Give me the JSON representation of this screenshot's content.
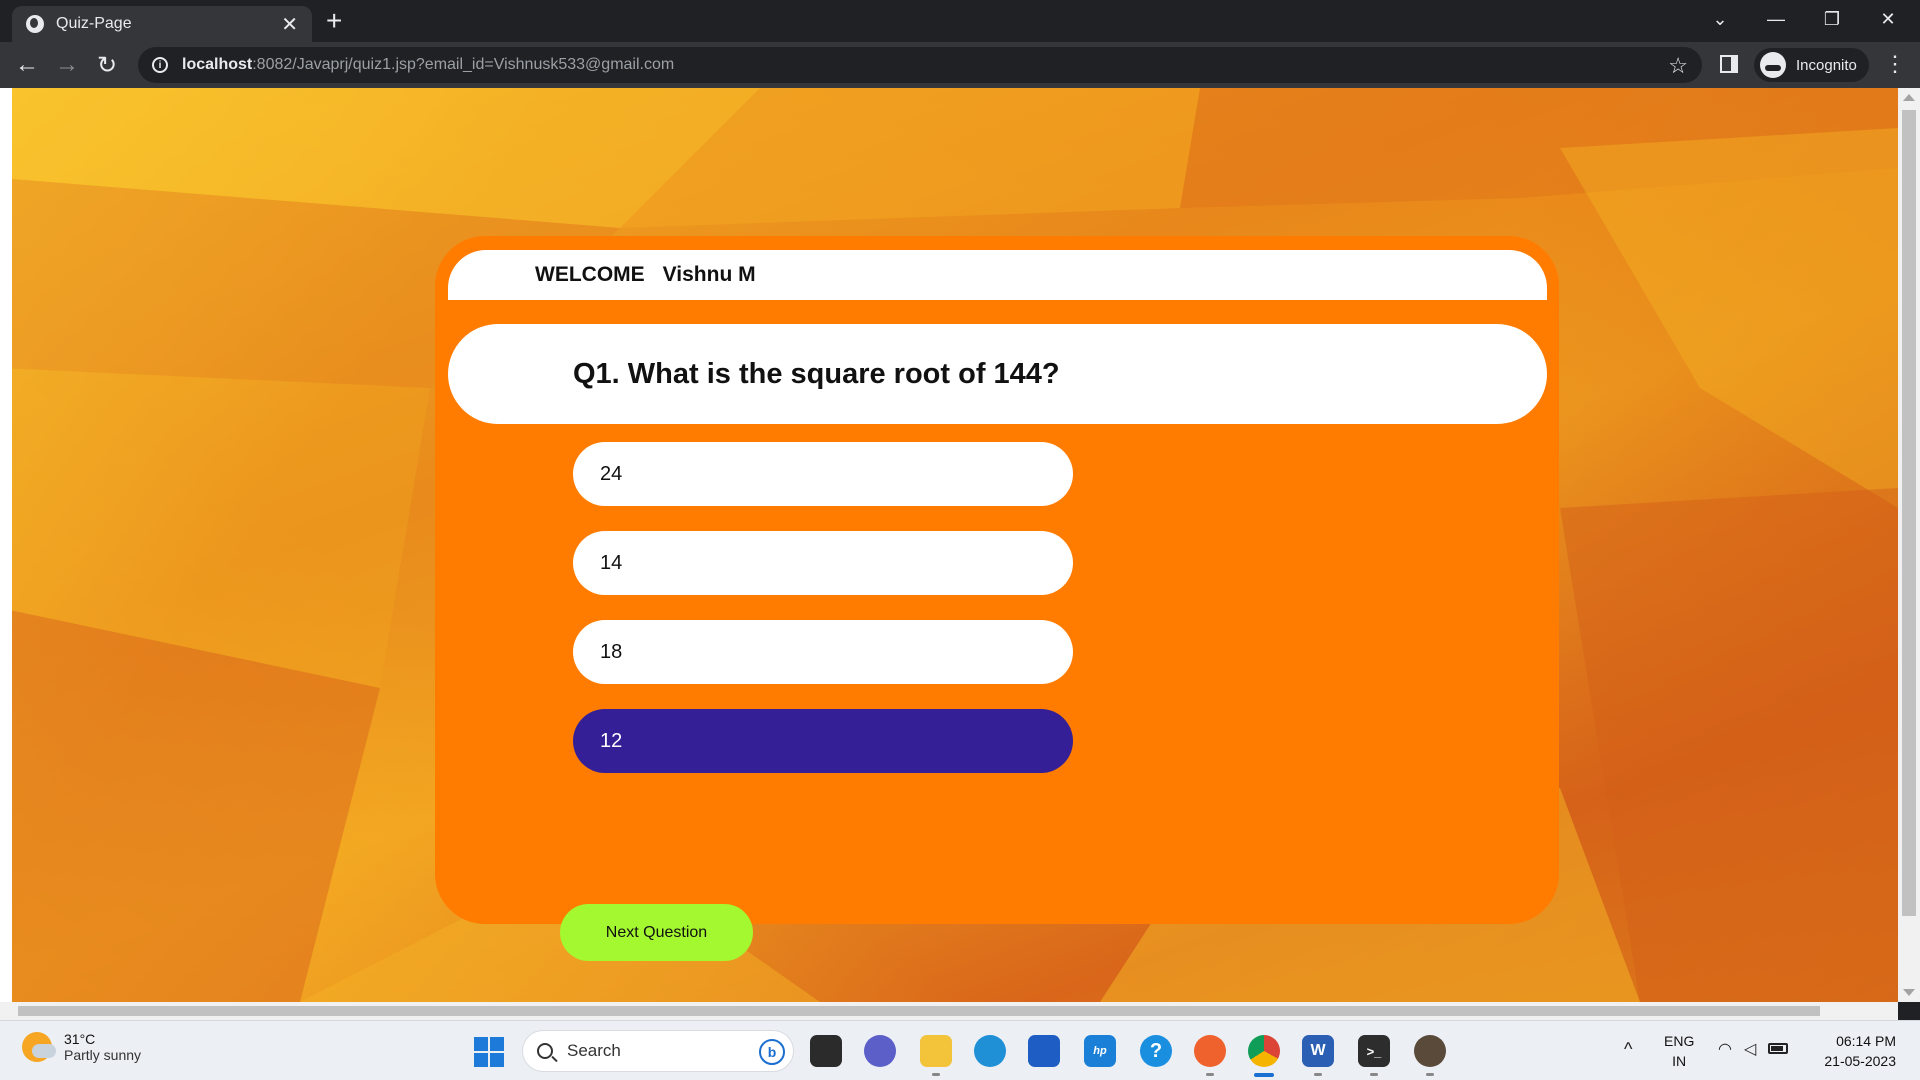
{
  "browser": {
    "tab_title": "Quiz-Page",
    "tab_close": "✕",
    "new_tab": "+",
    "url_host": "localhost",
    "url_path": ":8082/Javaprj/quiz1.jsp?email_id=Vishnusk533@gmail.com",
    "profile_label": "Incognito",
    "controls": {
      "tabsearch": "⌄",
      "minimize": "—",
      "restore": "❐",
      "close": "✕"
    },
    "nav": {
      "back": "←",
      "forward": "→",
      "reload": "↻",
      "star": "☆",
      "menu": "⋮"
    }
  },
  "quiz": {
    "welcome_label": "WELCOME",
    "user_name": "Vishnu M",
    "question": "Q1. What is the square root of 144?",
    "options": [
      {
        "label": "24",
        "selected": false
      },
      {
        "label": "14",
        "selected": false
      },
      {
        "label": "18",
        "selected": false
      },
      {
        "label": "12",
        "selected": true
      }
    ],
    "next_button": "Next Question"
  },
  "colors": {
    "card": "#ff7c00",
    "selected_option": "#341f97",
    "next_button": "#a3f82f"
  },
  "taskbar": {
    "weather_temp": "31°C",
    "weather_condition": "Partly sunny",
    "search_placeholder": "Search",
    "bing_label": "b",
    "language_line1": "ENG",
    "language_line2": "IN",
    "time": "06:14 PM",
    "date": "21-05-2023",
    "caret": "^",
    "apps": [
      "task-view-icon",
      "teams-chat-icon",
      "file-explorer-icon",
      "edge-icon",
      "microsoft-store-icon",
      "myhp-icon",
      "get-help-icon",
      "firefox-icon",
      "chrome-icon",
      "word-icon",
      "terminal-icon",
      "app-badge-icon"
    ]
  }
}
